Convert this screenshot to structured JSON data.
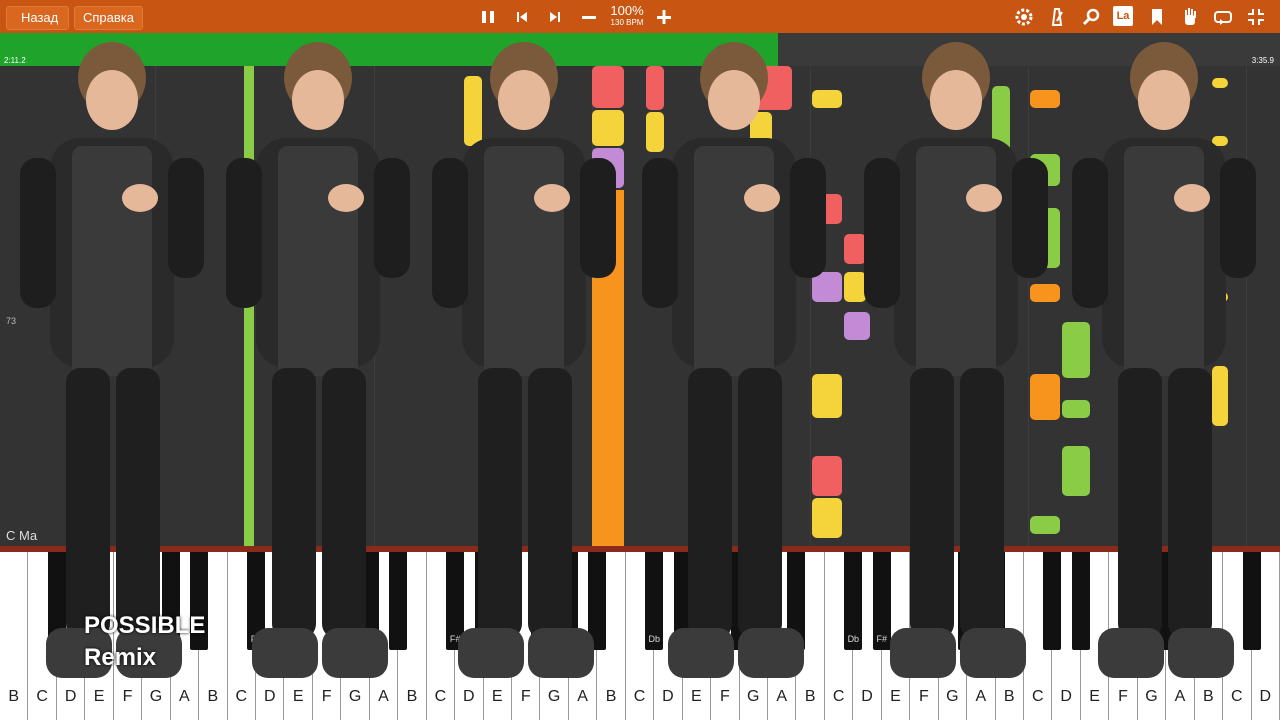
{
  "toolbar": {
    "back_label": "Назад",
    "help_label": "Справка",
    "zoom": "100%",
    "bpm": "130 BPM",
    "la_label": "La",
    "icons": [
      "pause-icon",
      "prev-icon",
      "next-icon",
      "minus-icon",
      "plus-icon",
      "gear-icon",
      "metronome-icon",
      "magnifier-icon",
      "la-icon",
      "bookmark-icon",
      "hand-icon",
      "loop-icon",
      "collapse-icon"
    ]
  },
  "progress": {
    "elapsed": "2:11.2",
    "total": "3:35.9",
    "fraction": 0.608
  },
  "roll": {
    "measure": "73",
    "chord": "C Ma"
  },
  "overlay": {
    "line1": "POSSIBLE",
    "line2": "Remix"
  },
  "piano": {
    "white_keys": [
      "B",
      "C",
      "D",
      "E",
      "F",
      "G",
      "A",
      "B",
      "C",
      "D",
      "E",
      "F",
      "G",
      "A",
      "B",
      "C",
      "D",
      "E",
      "F",
      "G",
      "A",
      "B",
      "C",
      "D",
      "E",
      "F",
      "G",
      "A",
      "B",
      "C",
      "D",
      "E",
      "F",
      "G",
      "A",
      "B",
      "C",
      "D",
      "E",
      "F",
      "G",
      "A",
      "B",
      "C",
      "D"
    ],
    "black_keys": [
      "Ab",
      "Db",
      "Eb",
      "F#",
      "Ab",
      "Db",
      "F#",
      "Db",
      "F#",
      "Db",
      "F#",
      "Ab",
      "Db",
      "F#"
    ]
  },
  "colors": {
    "toolbar": "#c85612",
    "progress": "#1fa32a",
    "orange": "#f7941d",
    "yellow": "#f5d33a",
    "red": "#f06060",
    "purple": "#c38bd6",
    "green": "#8bcc46"
  }
}
